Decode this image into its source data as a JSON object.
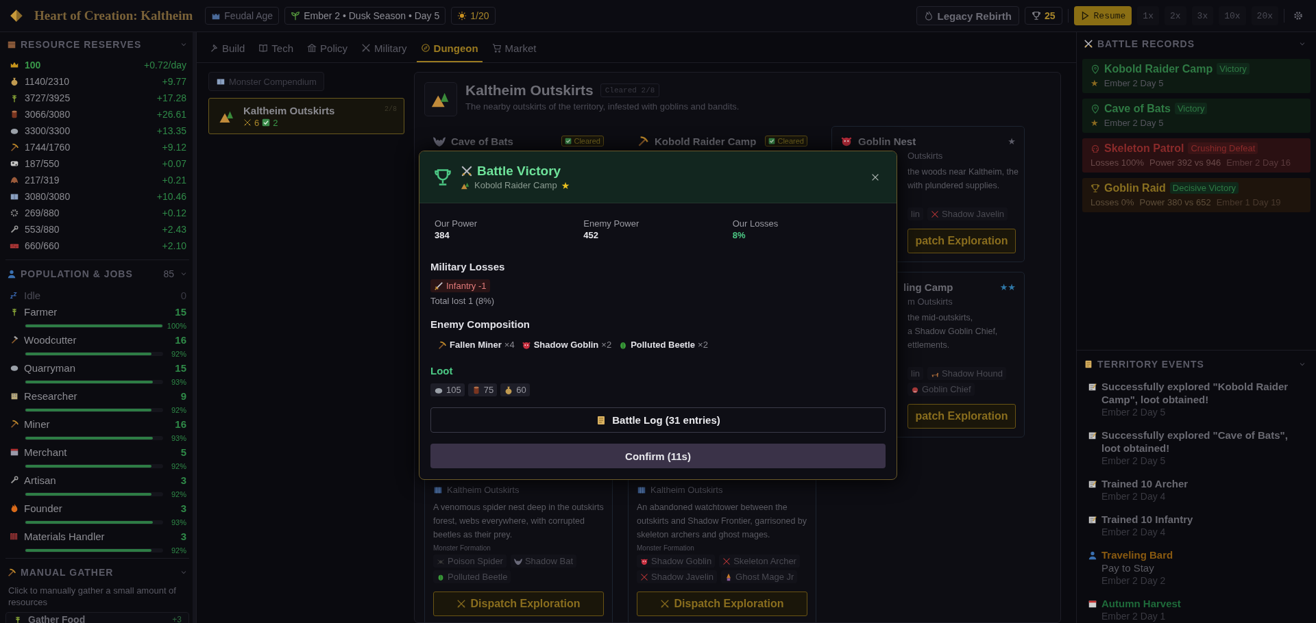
{
  "top_bar": {
    "title": "Heart of Creation: Kaltheim",
    "era": "Feudal Age",
    "calendar": "Ember 2 • Dusk Season • Day 5",
    "sun_count": "1/20",
    "legacy_button": "Legacy Rebirth",
    "trophies": "25",
    "resume_button": "Resume",
    "speeds": [
      "1x",
      "2x",
      "3x",
      "10x",
      "20x"
    ]
  },
  "resources": {
    "title": "RESOURCE RESERVES",
    "rows": [
      {
        "value": "100",
        "rate": "+0.72/day",
        "highlight": true
      },
      {
        "value": "1140/2310",
        "rate": "+9.77",
        "highlight": false
      },
      {
        "value": "3727/3925",
        "rate": "+17.28",
        "highlight": false
      },
      {
        "value": "3066/3080",
        "rate": "+26.61",
        "highlight": false
      },
      {
        "value": "3300/3300",
        "rate": "+13.35",
        "highlight": false
      },
      {
        "value": "1744/1760",
        "rate": "+9.12",
        "highlight": false
      },
      {
        "value": "187/550",
        "rate": "+0.07",
        "highlight": false
      },
      {
        "value": "217/319",
        "rate": "+0.21",
        "highlight": false
      },
      {
        "value": "3080/3080",
        "rate": "+10.46",
        "highlight": false
      },
      {
        "value": "269/880",
        "rate": "+0.12",
        "highlight": false
      },
      {
        "value": "553/880",
        "rate": "+2.43",
        "highlight": false
      },
      {
        "value": "660/660",
        "rate": "+2.10",
        "highlight": false
      }
    ]
  },
  "population": {
    "title": "POPULATION & JOBS",
    "total": "85",
    "idle": {
      "label": "Idle",
      "count": "0"
    },
    "jobs": [
      {
        "name": "Farmer",
        "count": "15",
        "level": 1.0,
        "percent": "100%"
      },
      {
        "name": "Woodcutter",
        "count": "16",
        "level": 0.92,
        "percent": "92%"
      },
      {
        "name": "Quarryman",
        "count": "15",
        "level": 0.93,
        "percent": "93%"
      },
      {
        "name": "Researcher",
        "count": "9",
        "level": 0.92,
        "percent": "92%"
      },
      {
        "name": "Miner",
        "count": "16",
        "level": 0.93,
        "percent": "93%"
      },
      {
        "name": "Merchant",
        "count": "5",
        "level": 0.92,
        "percent": "92%"
      },
      {
        "name": "Artisan",
        "count": "3",
        "level": 0.92,
        "percent": "92%"
      },
      {
        "name": "Founder",
        "count": "3",
        "level": 0.93,
        "percent": "93%"
      },
      {
        "name": "Materials Handler",
        "count": "3",
        "level": 0.92,
        "percent": "92%"
      }
    ]
  },
  "manual_gather": {
    "title": "MANUAL GATHER",
    "description": "Click to manually gather a small amount of resources",
    "actions": [
      {
        "label": "Gather Food",
        "amount": "+3"
      }
    ]
  },
  "tabs": [
    {
      "label": "Build",
      "selected": false
    },
    {
      "label": "Tech",
      "selected": false
    },
    {
      "label": "Policy",
      "selected": false
    },
    {
      "label": "Military",
      "selected": false
    },
    {
      "label": "Dungeon",
      "selected": true
    },
    {
      "label": "Market",
      "selected": false
    }
  ],
  "compendium_button": "Monster Compendium",
  "regions": [
    {
      "name": "Kaltheim Outskirts",
      "battles": "6",
      "cleared": "2",
      "progress": "2/8",
      "selected": true
    }
  ],
  "dungeon": {
    "name": "Kaltheim Outskirts",
    "cleared": "Cleared 2/8",
    "description": "The nearby outskirts of the territory, infested with goblins and bandits.",
    "columns": [
      {
        "cards": [
          {
            "kind": "covered",
            "title": "Cave of Bats",
            "badge": "Cleared"
          },
          {
            "kind": "tail",
            "location": "Kaltheim Outskirts",
            "description_lines": [
              "A venomous spider nest deep in the outskirts",
              "forest, webs everywhere, with corrupted",
              "beetles as their prey."
            ],
            "formation_label": "Monster Formation",
            "monster_rows": [
              [
                "Poison Spider",
                "Shadow Bat"
              ],
              [
                "Polluted Beetle"
              ]
            ],
            "button": "Dispatch Exploration"
          }
        ]
      },
      {
        "cards": [
          {
            "kind": "covered",
            "title": "Kobold Raider Camp",
            "badge": "Cleared"
          },
          {
            "kind": "tail",
            "location": "Kaltheim Outskirts",
            "description_lines": [
              "An abandoned watchtower between the",
              "outskirts and Shadow Frontier, garrisoned by",
              "skeleton archers and ghost mages."
            ],
            "formation_label": "Monster Formation",
            "monster_rows": [
              [
                "Shadow Goblin",
                "Skeleton Archer"
              ],
              [
                "Shadow Javelin",
                "Ghost Mage Jr"
              ]
            ],
            "button": "Dispatch Exploration"
          }
        ]
      },
      {
        "cards": [
          {
            "kind": "peek",
            "title": "Goblin Nest",
            "rating": "★",
            "color": "#5c5c68",
            "location": "Outskirts",
            "description_lines": [
              "the woods near Kaltheim, the",
              "with plundered supplies."
            ],
            "monster_rows": [
              [
                "lin",
                "Shadow Javelin"
              ]
            ],
            "button": "patch Exploration"
          },
          {
            "kind": "partial",
            "title": "ling Camp",
            "rating": "★★",
            "color": "#2f78a8",
            "location": "m Outskirts",
            "description_lines": [
              "the mid-outskirts,",
              "a Shadow Goblin Chief,",
              "ettlements."
            ],
            "monster_rows": [
              [
                "lin",
                "Shadow Hound"
              ],
              [
                "Goblin Chief"
              ]
            ],
            "button": "patch Exploration"
          }
        ]
      }
    ]
  },
  "battle_result": {
    "title": "Battle Victory",
    "location": "Kobold Raider Camp",
    "rating": "★",
    "stats": [
      {
        "label": "Our Power",
        "value": "384",
        "kind": "plain"
      },
      {
        "label": "Enemy Power",
        "value": "452",
        "kind": "plain"
      },
      {
        "label": "Our Losses",
        "value": "8%",
        "kind": "good"
      }
    ],
    "losses_title": "Military Losses",
    "losses": [
      "Infantry -1"
    ],
    "losses_total": "Total lost 1 (8%)",
    "enemy_title": "Enemy Composition",
    "enemies": [
      {
        "name": "Fallen Miner",
        "count": "×4"
      },
      {
        "name": "Shadow Goblin",
        "count": "×2"
      },
      {
        "name": "Polluted Beetle",
        "count": "×2"
      }
    ],
    "loot_title": "Loot",
    "loot": [
      "105",
      "75",
      "60"
    ],
    "log_button": "Battle Log (31 entries)",
    "confirm_button": "Confirm (11s)"
  },
  "battle_records": {
    "title": "BATTLE RECORDS",
    "records": [
      {
        "kind": "victory",
        "name": "Kobold Raider Camp",
        "result": "Victory",
        "rating": "★",
        "details": [
          "Ember 2 Day 5"
        ]
      },
      {
        "kind": "victory",
        "name": "Cave of Bats",
        "result": "Victory",
        "rating": "★",
        "details": [
          "Ember 2 Day 5"
        ]
      },
      {
        "kind": "defeat",
        "name": "Skeleton Patrol",
        "result": "Crushing Defeat",
        "details": [
          "Losses 100%",
          "Power 392 vs 946",
          "Ember 2 Day 16"
        ]
      },
      {
        "kind": "decisive",
        "name": "Goblin Raid",
        "result": "Decisive Victory",
        "details": [
          "Losses 0%",
          "Power 380 vs 652",
          "Ember 1 Day 19"
        ]
      }
    ]
  },
  "territory_events": {
    "title": "TERRITORY EVENTS",
    "events": [
      {
        "kind": "log",
        "title": "Successfully explored \"Kobold Raider Camp\", loot obtained!",
        "date": "Ember 2 Day 5"
      },
      {
        "kind": "log",
        "title": "Successfully explored \"Cave of Bats\", loot obtained!",
        "date": "Ember 2 Day 5"
      },
      {
        "kind": "log",
        "title": "Trained 10 Archer",
        "date": "Ember 2 Day 4"
      },
      {
        "kind": "log",
        "title": "Trained 10 Infantry",
        "date": "Ember 2 Day 4"
      },
      {
        "kind": "visitor",
        "title": "Traveling Bard",
        "subtitle": "Pay to Stay",
        "date": "Ember 2 Day 2"
      },
      {
        "kind": "season",
        "title": "Autumn Harvest",
        "date": "Ember 2 Day 1"
      }
    ]
  }
}
